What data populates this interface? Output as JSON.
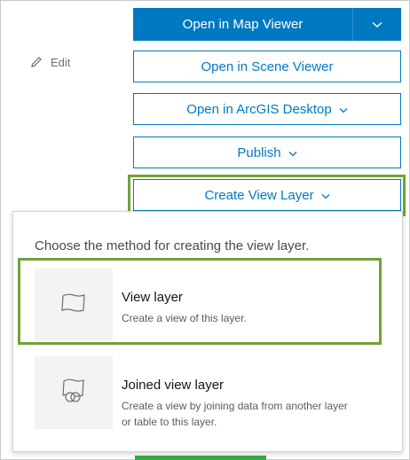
{
  "edit_label": "Edit",
  "buttons": {
    "map_viewer": "Open in Map Viewer",
    "scene_viewer": "Open in Scene Viewer",
    "arcgis_desktop": "Open in ArcGIS Desktop",
    "publish": "Publish",
    "create_view_layer": "Create View Layer"
  },
  "dropdown": {
    "title": "Choose the method for creating the view layer.",
    "options": [
      {
        "name": "View layer",
        "description": "Create a view of this layer."
      },
      {
        "name": "Joined view layer",
        "description": "Create a view by joining data from another layer or table to this layer."
      }
    ]
  },
  "colors": {
    "accent": "#0079c1",
    "highlight": "#6fa236"
  }
}
